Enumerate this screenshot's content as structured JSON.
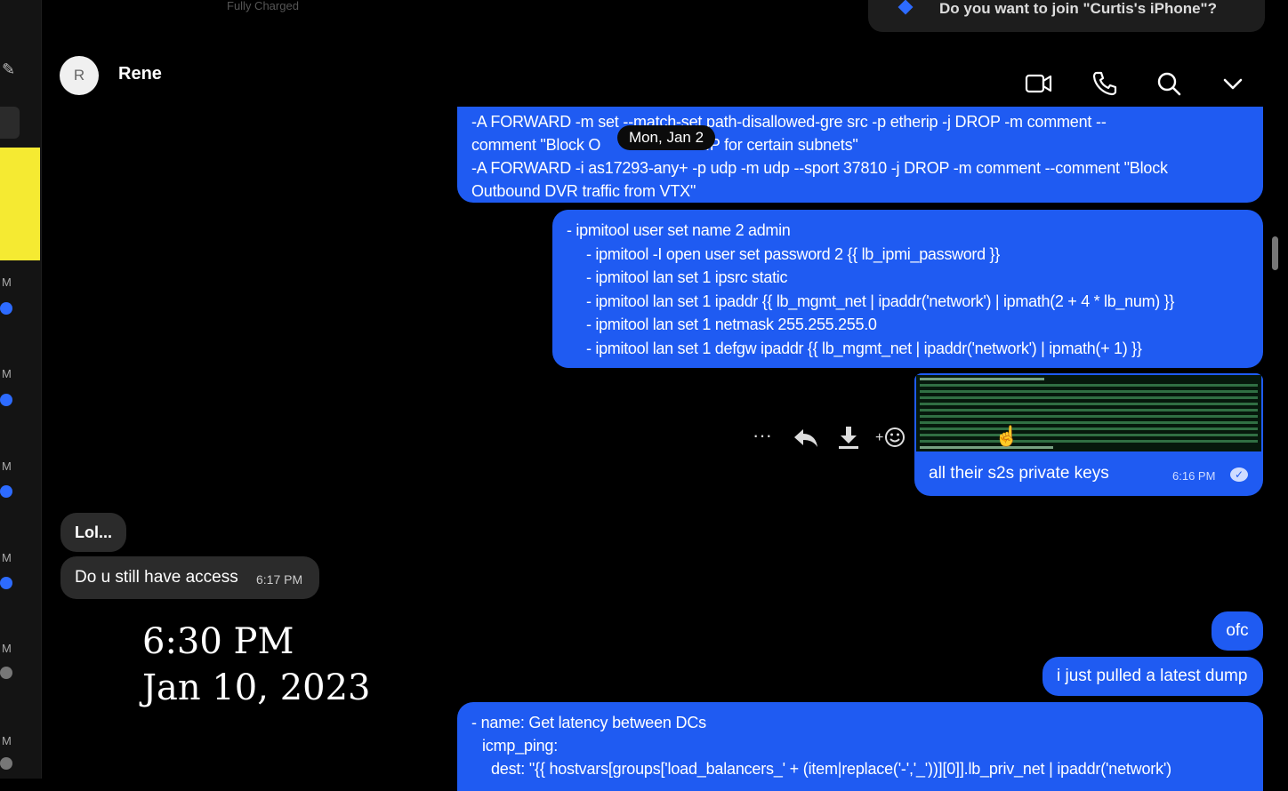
{
  "topbar": {
    "fragment": "Fully Charged"
  },
  "notification": {
    "text": "Do you want to join \"Curtis's iPhone\"?"
  },
  "sidebar": {
    "yellow_item": "",
    "markers": [
      "M",
      "M",
      "M",
      "M",
      "M",
      "M"
    ]
  },
  "header": {
    "avatar_initial": "R",
    "contact_name": "Rene"
  },
  "date_separator": "Mon, Jan 2",
  "messages": {
    "iptables": {
      "lines": [
        "-A FORWARD -m set --match-set path-disallowed-gre src -p etherip -j DROP -m comment --",
        "comment \"Block O",
        "rIP for certain subnets\"",
        "-A FORWARD -i as17293-any+ -p udp -m udp --sport 37810 -j DROP -m comment --comment \"Block",
        "Outbound DVR traffic from VTX\""
      ]
    },
    "ipmitool": {
      "lines": [
        "- ipmitool user set name 2 admin",
        "- ipmitool -I open user set password 2 {{ lb_ipmi_password }}",
        "- ipmitool lan set 1 ipsrc static",
        "- ipmitool lan set 1 ipaddr {{ lb_mgmt_net | ipaddr('network') | ipmath(2 + 4 * lb_num) }}",
        "- ipmitool lan set 1 netmask 255.255.255.0",
        "- ipmitool lan set 1 defgw ipaddr {{ lb_mgmt_net | ipaddr('network') | ipmath(+ 1) }}"
      ]
    },
    "keys": {
      "text": "all their s2s private keys",
      "time": "6:16 PM"
    },
    "lol": {
      "text": "Lol..."
    },
    "access": {
      "text": "Do u still have access",
      "time": "6:17 PM"
    },
    "ofc": {
      "text": "ofc"
    },
    "dump": {
      "text": "i just pulled a latest dump"
    },
    "latency": {
      "lines": [
        "- name: Get latency between DCs",
        "icmp_ping:",
        "dest: \"{{ hostvars[groups['load_balancers_' + (item|replace('-','_'))][0]].lb_priv_net | ipaddr('network')"
      ]
    }
  },
  "overlay": {
    "time": "6:30 PM",
    "date": "Jan 10, 2023"
  },
  "icons": [
    "video-call-icon",
    "phone-icon",
    "search-icon",
    "chevron-down-icon",
    "more-icon",
    "reply-icon",
    "download-icon",
    "add-reaction-icon",
    "read-check-icon",
    "compose-icon"
  ],
  "colors": {
    "bubble_out": "#1f5bf2",
    "bubble_in": "#2b2b2b",
    "background": "#000000",
    "sidebar_highlight": "#f5ea32"
  }
}
